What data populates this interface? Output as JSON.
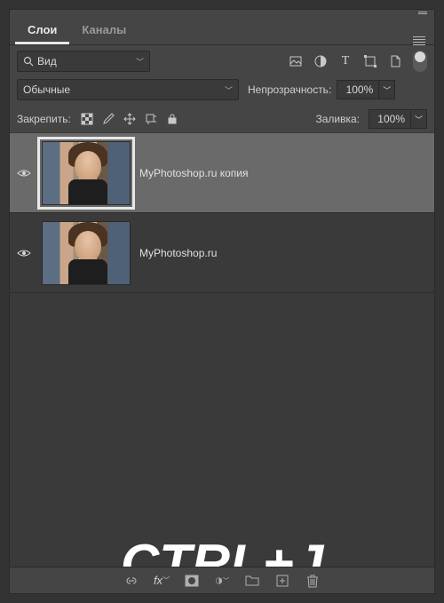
{
  "tabs": {
    "layers": "Слои",
    "channels": "Каналы"
  },
  "filter": {
    "label": "Вид"
  },
  "blend_mode": "Обычные",
  "opacity": {
    "label": "Непрозрачность:",
    "value": "100%"
  },
  "fill": {
    "label": "Заливка:",
    "value": "100%"
  },
  "lock": {
    "label": "Закрепить:"
  },
  "layers": [
    {
      "name": "MyPhotoshop.ru копия",
      "selected": true
    },
    {
      "name": "MyPhotoshop.ru",
      "selected": false
    }
  ],
  "overlay_text": "CTRL+J",
  "bottom_fx": "fx",
  "icons": {
    "search": "⚲",
    "image": "▣",
    "adjust": "◐",
    "type": "T",
    "shape": "▢",
    "smart": "🗎",
    "eye": "👁",
    "link": "⚭",
    "mask": "◻",
    "adjust2": "◐",
    "folder": "🗀",
    "new": "⊞",
    "trash": "🗑"
  }
}
